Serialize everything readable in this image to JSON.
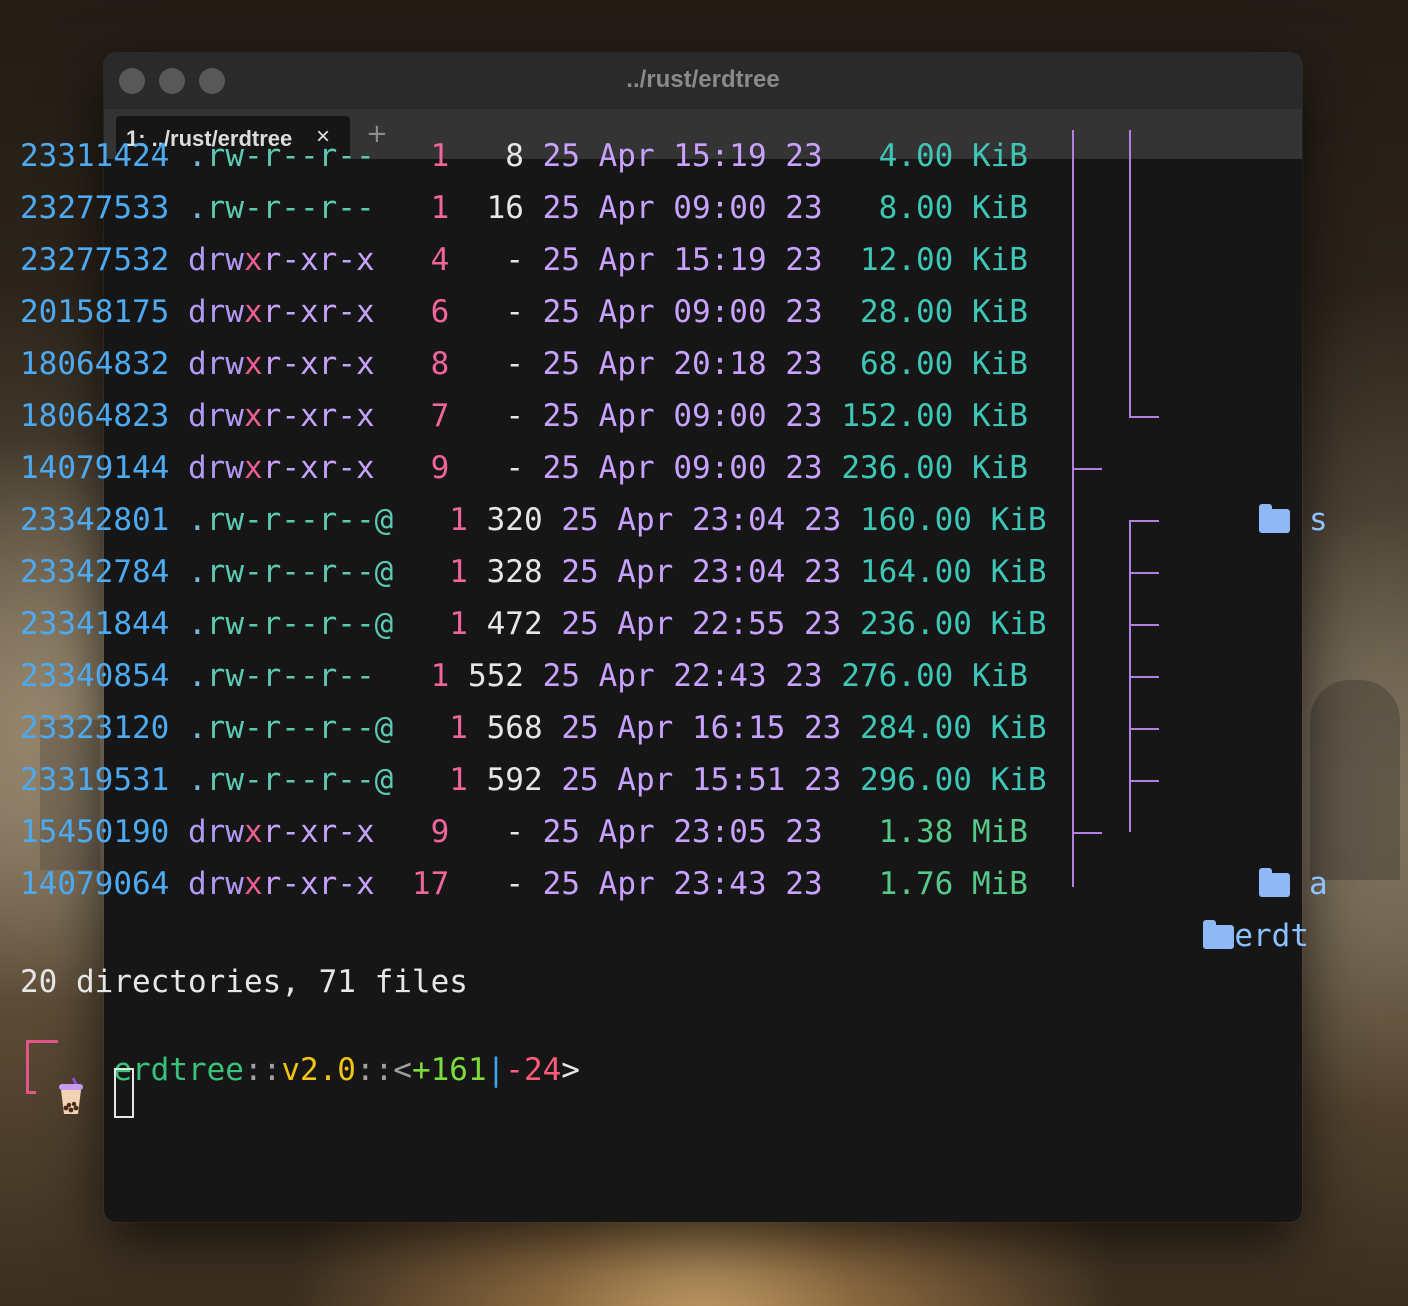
{
  "window": {
    "title": "../rust/erdtree"
  },
  "tabs": [
    {
      "label": "1: ../rust/erdtree",
      "close": "×"
    }
  ],
  "new_tab": "+",
  "rows": [
    {
      "inode": "23311424",
      "perm": [
        [
          ".",
          ".c-dim"
        ],
        [
          "rw-r--r--",
          "a"
        ]
      ],
      "links": "1",
      "size": "8",
      "date": "25 Apr 15:19 23",
      "disk": "4.00",
      "unit": "KiB"
    },
    {
      "inode": "23277533",
      "perm": [
        [
          ".",
          "d"
        ],
        [
          "rw-r--r--",
          "a"
        ]
      ],
      "links": "1",
      "size": "16",
      "date": "25 Apr 09:00 23",
      "disk": "8.00",
      "unit": "KiB"
    },
    {
      "inode": "23277532",
      "perm": [
        [
          "drw",
          "dir"
        ],
        [
          "x",
          "x"
        ],
        [
          "r-x",
          "rx"
        ],
        [
          "r-x",
          "rx"
        ]
      ],
      "links": "4",
      "size": "-",
      "date": "25 Apr 15:19 23",
      "disk": "12.00",
      "unit": "KiB"
    },
    {
      "inode": "20158175",
      "perm": [
        [
          "drw",
          "dir"
        ],
        [
          "x",
          "x"
        ],
        [
          "r-x",
          "rx"
        ],
        [
          "r-x",
          "rx"
        ]
      ],
      "links": "6",
      "size": "-",
      "date": "25 Apr 09:00 23",
      "disk": "28.00",
      "unit": "KiB"
    },
    {
      "inode": "18064832",
      "perm": [
        [
          "drw",
          "dir"
        ],
        [
          "x",
          "x"
        ],
        [
          "r-x",
          "rx"
        ],
        [
          "r-x",
          "rx"
        ]
      ],
      "links": "8",
      "size": "-",
      "date": "25 Apr 20:18 23",
      "disk": "68.00",
      "unit": "KiB"
    },
    {
      "inode": "18064823",
      "perm": [
        [
          "drw",
          "dir"
        ],
        [
          "x",
          "x"
        ],
        [
          "r-x",
          "rx"
        ],
        [
          "r-x",
          "rx"
        ]
      ],
      "links": "7",
      "size": "-",
      "date": "25 Apr 09:00 23",
      "disk": "152.00",
      "unit": "KiB"
    },
    {
      "inode": "14079144",
      "perm": [
        [
          "drw",
          "dir"
        ],
        [
          "x",
          "x"
        ],
        [
          "r-x",
          "rx"
        ],
        [
          "r-x",
          "rx"
        ]
      ],
      "links": "9",
      "size": "-",
      "date": "25 Apr 09:00 23",
      "disk": "236.00",
      "unit": "KiB"
    },
    {
      "inode": "23342801",
      "perm": [
        [
          ".",
          "d"
        ],
        [
          "rw-r--r--@",
          "a"
        ]
      ],
      "links": "1",
      "size": "320",
      "date": "25 Apr 23:04 23",
      "disk": "160.00",
      "unit": "KiB"
    },
    {
      "inode": "23342784",
      "perm": [
        [
          ".",
          "d"
        ],
        [
          "rw-r--r--@",
          "a"
        ]
      ],
      "links": "1",
      "size": "328",
      "date": "25 Apr 23:04 23",
      "disk": "164.00",
      "unit": "KiB"
    },
    {
      "inode": "23341844",
      "perm": [
        [
          ".",
          "d"
        ],
        [
          "rw-r--r--@",
          "a"
        ]
      ],
      "links": "1",
      "size": "472",
      "date": "25 Apr 22:55 23",
      "disk": "236.00",
      "unit": "KiB"
    },
    {
      "inode": "23340854",
      "perm": [
        [
          ".",
          "d"
        ],
        [
          "rw-r--r--",
          "a"
        ]
      ],
      "links": "1",
      "size": "552",
      "date": "25 Apr 22:43 23",
      "disk": "276.00",
      "unit": "KiB"
    },
    {
      "inode": "23323120",
      "perm": [
        [
          ".",
          "d"
        ],
        [
          "rw-r--r--@",
          "a"
        ]
      ],
      "links": "1",
      "size": "568",
      "date": "25 Apr 16:15 23",
      "disk": "284.00",
      "unit": "KiB"
    },
    {
      "inode": "23319531",
      "perm": [
        [
          ".",
          "d"
        ],
        [
          "rw-r--r--@",
          "a"
        ]
      ],
      "links": "1",
      "size": "592",
      "date": "25 Apr 15:51 23",
      "disk": "296.00",
      "unit": "KiB"
    },
    {
      "inode": "15450190",
      "perm": [
        [
          "drw",
          "dir"
        ],
        [
          "x",
          "x"
        ],
        [
          "r-x",
          "rx"
        ],
        [
          "r-x",
          "rx"
        ]
      ],
      "links": "9",
      "size": "-",
      "date": "25 Apr 23:05 23",
      "disk": "1.38",
      "unit": "MiB"
    },
    {
      "inode": "14079064",
      "perm": [
        [
          "drw",
          "dir"
        ],
        [
          "x",
          "x"
        ],
        [
          "r-x",
          "rx"
        ],
        [
          "r-x",
          "rx"
        ]
      ],
      "links": "17",
      "size": "-",
      "date": "25 Apr 23:43 23",
      "disk": "1.76",
      "unit": "MiB"
    }
  ],
  "tree_names": {
    "row7": "s",
    "row14": "a",
    "row15": "erdt"
  },
  "summary": "20 directories, 71 files",
  "prompt": {
    "name": "erdtree",
    "sep1": "::",
    "version": "v2.0",
    "sep2": "::<",
    "added": "+161",
    "bar": "|",
    "removed": "-24",
    "close": ">"
  },
  "colors": {
    "inode": "#4eaaf0",
    "attr": "#5bc9b3",
    "dir": "#b398f5",
    "exec": "#ee5d93",
    "tree": "#b07fe0",
    "kib": "#3ec6b6",
    "mib": "#57c98a",
    "folder": "#8fb8f6"
  }
}
